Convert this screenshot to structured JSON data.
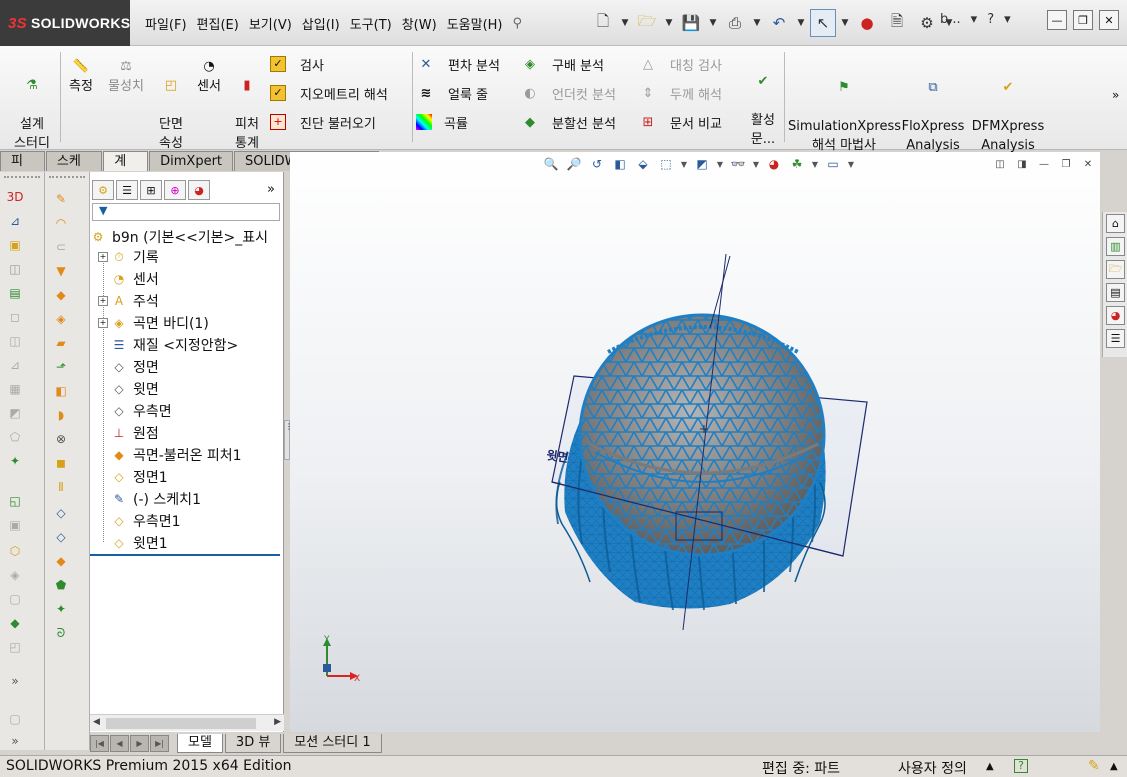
{
  "app": {
    "logo_ds": "3S",
    "logo_text": "SOLIDWORKS"
  },
  "menu": [
    "파일(F)",
    "편집(E)",
    "보기(V)",
    "삽입(I)",
    "도구(T)",
    "창(W)",
    "도움말(H)"
  ],
  "help": {
    "user": "b...",
    "question": "?"
  },
  "command_manager": {
    "big": {
      "design_study": "설계\n스터디",
      "measure": "측정",
      "mass_props": "물성치",
      "section_props": "단면\n속성",
      "sensor": "센서",
      "feature_stats": "피처\n통계",
      "simulation_xpress": "SimulationXpress\n해석 마법사",
      "flo_xpress": "FloXpress\nAnalysis\nWizard",
      "dfm_xpress": "DFMXpress\nAnalysis\nWizard",
      "activate_docs": "활성\n문..."
    },
    "col1": [
      "검사",
      "지오메트리 해석",
      "진단 불러오기"
    ],
    "col2": [
      "편차 분석",
      "얼룩 줄",
      "곡률"
    ],
    "col3": [
      "구배 분석",
      "언더컷 분석",
      "분할선 분석"
    ],
    "col4": [
      "대칭 검사",
      "두께 해석",
      "문서 비교"
    ]
  },
  "tabs": [
    "피처",
    "스케치",
    "계산",
    "DimXpert",
    "SOLIDWORKS 애드인"
  ],
  "active_tab": "계산",
  "feature_tree": {
    "root": "b9n  (기본<<기본>_표시",
    "items": [
      {
        "label": "기록",
        "expand": true
      },
      {
        "label": "센서",
        "expand": false
      },
      {
        "label": "주석",
        "expand": true
      },
      {
        "label": "곡면 바디(1)",
        "expand": true
      },
      {
        "label": "재질 <지정안함>",
        "expand": false
      },
      {
        "label": "정면",
        "expand": false
      },
      {
        "label": "윗면",
        "expand": false
      },
      {
        "label": "우측면",
        "expand": false
      },
      {
        "label": "원점",
        "expand": false
      },
      {
        "label": "곡면-불러온 피처1",
        "expand": false
      },
      {
        "label": "정면1",
        "expand": false
      },
      {
        "label": "(-) 스케치1",
        "expand": false
      },
      {
        "label": "우측면1",
        "expand": false
      },
      {
        "label": "윗면1",
        "expand": false
      }
    ]
  },
  "bottom_tabs": [
    "모델",
    "3D 뷰",
    "모션 스터디 1"
  ],
  "view": {
    "plane_label": "윗면",
    "axis_x": "X",
    "axis_y": "Y",
    "model_color": "#1f7fc4",
    "sphere_color": "#8d8d8d"
  },
  "status": {
    "edition": "SOLIDWORKS Premium 2015 x64 Edition",
    "editing": "편집 중: 파트",
    "custom": "사용자 정의"
  }
}
